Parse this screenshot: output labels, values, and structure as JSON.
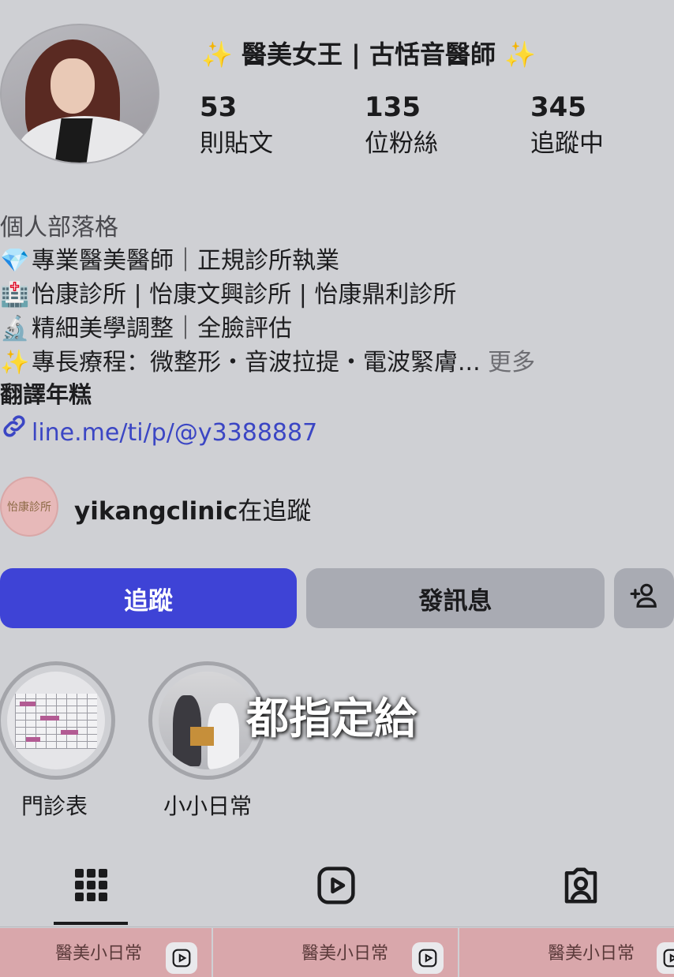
{
  "profile": {
    "username": "醫美女王 | 古恬音醫師",
    "sparkle_left": "✨",
    "sparkle_right": "✨"
  },
  "stats": [
    {
      "value": "53",
      "label": "則貼文"
    },
    {
      "value": "135",
      "label": "位粉絲"
    },
    {
      "value": "345",
      "label": "追蹤中"
    }
  ],
  "bio": {
    "category": "個人部落格",
    "lines": [
      {
        "emoji": "💎",
        "text": "專業醫美醫師｜正規診所執業"
      },
      {
        "emoji": "🏥",
        "text": "怡康診所 | 怡康文興診所 | 怡康鼎利診所"
      },
      {
        "emoji": "🔬",
        "text": "精細美學調整｜全臉評估"
      },
      {
        "emoji": "✨",
        "text": "專長療程：微整形・音波拉提・電波緊膚..."
      }
    ],
    "more_label": "更多",
    "translate_label": "翻譯年糕",
    "link_icon": "🔗",
    "link": "line.me/ti/p/@y3388887"
  },
  "mutual": {
    "avatar_text": "怡康診所",
    "account": "yikangclinic",
    "suffix": "在追蹤"
  },
  "actions": {
    "follow": "追蹤",
    "message": "發訊息",
    "add_user_icon": "add-user-icon"
  },
  "highlights": [
    {
      "label": "門診表"
    },
    {
      "label": "小小日常"
    }
  ],
  "overlay_caption": "都指定給",
  "tabs": {
    "grid_icon": "grid-icon",
    "reels_icon": "reels-icon",
    "tagged_icon": "tagged-icon"
  },
  "thumbnails": [
    {
      "label": "醫美小日常"
    },
    {
      "label": "醫美小日常"
    },
    {
      "label": "醫美小日常"
    }
  ],
  "colors": {
    "follow_button": "#3e43d6",
    "link": "#3b46c4",
    "background": "#cfd0d4"
  }
}
